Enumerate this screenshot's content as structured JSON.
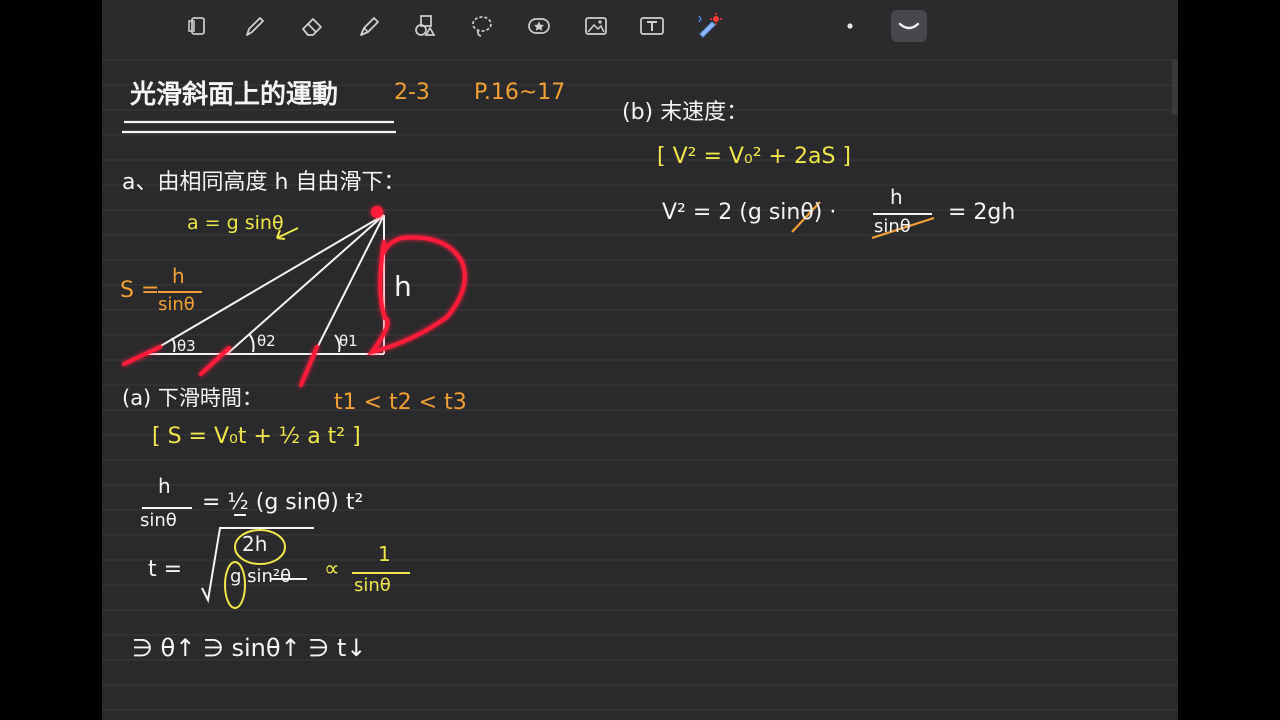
{
  "toolbar": {
    "tools": [
      {
        "name": "page-layout-icon",
        "active": false
      },
      {
        "name": "pen-icon",
        "active": false
      },
      {
        "name": "eraser-icon",
        "active": false
      },
      {
        "name": "highlighter-icon",
        "active": false
      },
      {
        "name": "shapes-icon",
        "active": false
      },
      {
        "name": "lasso-icon",
        "active": false
      },
      {
        "name": "sticker-icon",
        "active": false
      },
      {
        "name": "image-icon",
        "active": false
      },
      {
        "name": "text-icon",
        "active": false
      },
      {
        "name": "laser-pointer-icon",
        "active": false
      },
      {
        "name": "pen-dot-size-icon",
        "active": false
      },
      {
        "name": "pen-stroke-size-icon",
        "active": true
      }
    ]
  },
  "notes": {
    "title": "光滑斜面上的運動",
    "section": "2-3",
    "pages": "P.16~17",
    "part_a": "a、由相同高度 h 自由滑下：",
    "accel_label": "a = g sinθ",
    "dist_label_s": "S =",
    "dist_num": "h",
    "dist_den": "sinθ",
    "height_label": "h",
    "angle_1": "θ1",
    "angle_2": "θ2",
    "angle_3": "θ3",
    "q_time": "(a) 下滑時間：",
    "time_order": "t1 < t2 < t3",
    "formula_s": "[ S = V₀t + ½ a t² ]",
    "eq1_left_num": "h",
    "eq1_left_den": "sinθ",
    "eq1_right": "= ½ (g sinθ) t²",
    "eq2_left": "t =",
    "eq2_rad_num": "2h",
    "eq2_rad_den": "g sin²θ",
    "eq2_prop": "∝",
    "eq2_frac_num": "1",
    "eq2_frac_den": "sinθ",
    "conclusion": "∋ θ↑ ∋ sinθ↑ ∋ t↓",
    "q_speed": "(b) 末速度：",
    "formula_v": "[ V² = V₀² + 2aS ]",
    "eq3_left": "V² = 2 (g sinθ) ·",
    "eq3_num": "h",
    "eq3_den": "sinθ",
    "eq3_result": "= 2gh"
  },
  "colors": {
    "page_bg": "#2a2a2c",
    "ruled_line": "#3b3b3e",
    "ink_white": "#f4f4f4",
    "ink_yellow": "#efe64a",
    "ink_orange": "#f2a033",
    "laser_red": "#ff1d3a"
  }
}
